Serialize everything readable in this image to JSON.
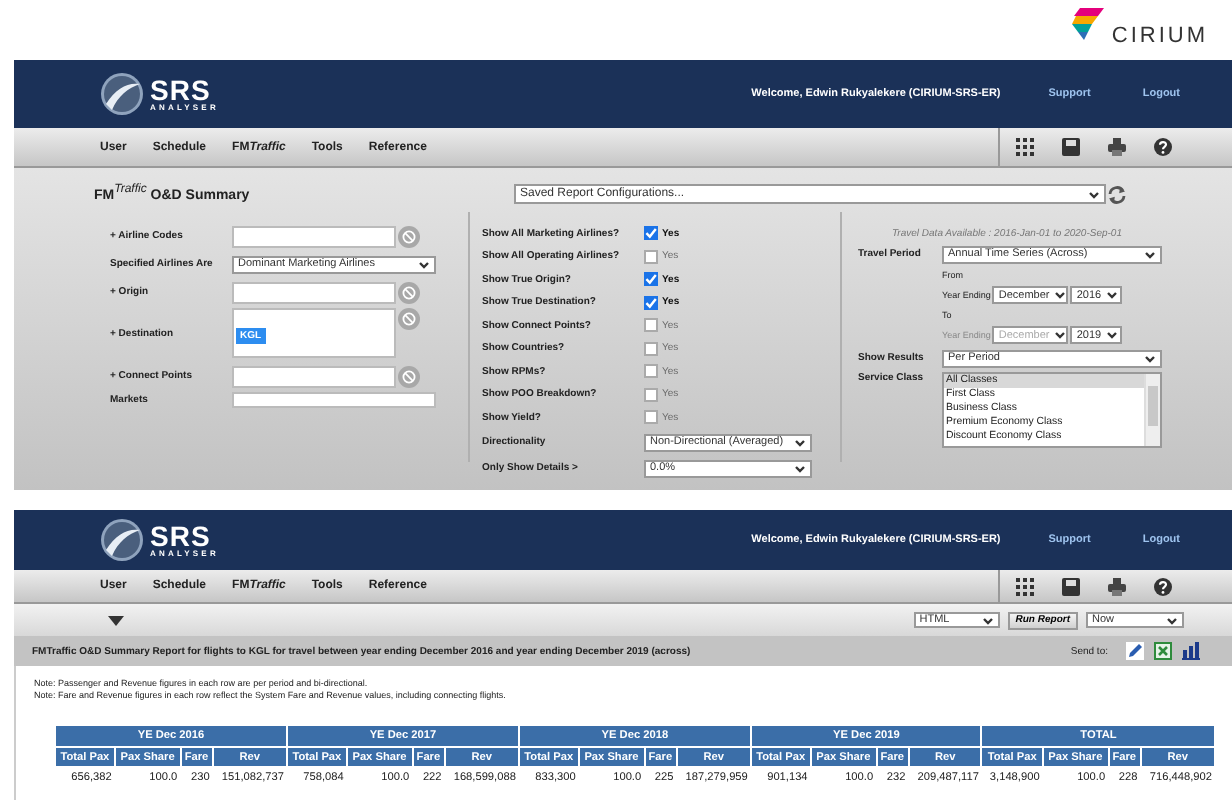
{
  "brand": {
    "name": "CIRIUM"
  },
  "form_screen": {
    "header": {
      "logo_text": "SRS",
      "logo_subtext": "ANALYSER",
      "welcome": "Welcome, Edwin Rukyalekere (CIRIUM-SRS-ER)",
      "links": [
        "Support",
        "Logout"
      ]
    },
    "nav": [
      {
        "label": "User"
      },
      {
        "label": "Schedule"
      },
      {
        "label": "FM",
        "italic_part": "Traffic"
      },
      {
        "label": "Tools"
      },
      {
        "label": "Reference"
      }
    ],
    "title": "FM$^{Traffic}$ O&D Summary",
    "saved_config": {
      "value": "Saved Report Configurations..."
    },
    "fields": [
      {
        "kind": "lookup",
        "label": "+ Airline Codes"
      },
      {
        "kind": "select",
        "label": "Specified Airlines Are",
        "value": "Dominant Marketing Airlines"
      },
      {
        "kind": "lookup",
        "label": "+ Origin"
      },
      {
        "kind": "lookup_tall",
        "label": "+ Destination",
        "tokens": [
          "KGL"
        ]
      },
      {
        "kind": "lookup",
        "label": "+ Connect Points"
      },
      {
        "kind": "text",
        "label": "Markets"
      }
    ],
    "options": [
      {
        "label": "Show All Marketing Airlines?",
        "text": "Yes",
        "checked": true
      },
      {
        "label": "Show All Operating Airlines?",
        "text": "Yes",
        "checked": false
      },
      {
        "label": "Show True Origin?",
        "text": "Yes",
        "checked": true
      },
      {
        "label": "Show True Destination?",
        "text": "Yes",
        "checked": true
      },
      {
        "label": "Show Connect Points?",
        "text": "Yes",
        "checked": false
      },
      {
        "label": "Show Countries?",
        "text": "Yes",
        "checked": false
      },
      {
        "label": "Show RPMs?",
        "text": "Yes",
        "checked": false
      },
      {
        "label": "Show POO Breakdown?",
        "text": "Yes",
        "checked": false
      },
      {
        "label": "Show Yield?",
        "text": "Yes",
        "checked": false
      }
    ],
    "option_selects": [
      {
        "label": "Directionality",
        "value": "Non-Directional (Averaged)"
      },
      {
        "label": "Only Show Details >",
        "value": "0.0%"
      }
    ],
    "availability": "Travel Data Available :  2016-Jan-01 to 2020-Sep-01",
    "travel_period": {
      "label": "Travel Period",
      "value": "Annual Time Series (Across)"
    },
    "range": [
      {
        "caption": "From",
        "label": "Year Ending",
        "month": "December",
        "month_disabled": false,
        "year": "2016"
      },
      {
        "caption": "To",
        "label": "Year Ending",
        "month": "December",
        "month_disabled": true,
        "year": "2019"
      }
    ],
    "show_results": {
      "label": "Show Results",
      "value": "Per Period"
    },
    "service_class": {
      "label": "Service Class",
      "items": [
        {
          "label": "All Classes",
          "selected": true
        },
        {
          "label": "First Class",
          "selected": false
        },
        {
          "label": "Business Class",
          "selected": false
        },
        {
          "label": "Premium Economy Class",
          "selected": false
        },
        {
          "label": "Discount Economy Class",
          "selected": false
        }
      ]
    }
  },
  "report_screen": {
    "header": {
      "logo_text": "SRS",
      "logo_subtext": "ANALYSER",
      "welcome": "Welcome, Edwin Rukyalekere (CIRIUM-SRS-ER)",
      "links": [
        "Support",
        "Logout"
      ]
    },
    "nav": [
      {
        "label": "User"
      },
      {
        "label": "Schedule"
      },
      {
        "label": "FM",
        "italic_part": "Traffic"
      },
      {
        "label": "Tools"
      },
      {
        "label": "Reference"
      }
    ],
    "output_format": "HTML",
    "run_button": "Run Report",
    "run_time": "Now",
    "report_title": "FMTraffic O&D Summary Report for flights to KGL for travel between year ending December 2016 and year ending December 2019 (across)",
    "send_to": "Send to:",
    "notes": [
      "Note: Passenger and Revenue figures in each row are per period and bi-directional.",
      "Note: Fare and Revenue figures in each row reflect the System Fare and Revenue values, including connecting flights."
    ],
    "table": {
      "groups": [
        {
          "title": "YE Dec 2016",
          "columns": [
            "Total Pax",
            "Pax Share",
            "Fare",
            "Rev"
          ]
        },
        {
          "title": "YE Dec 2017",
          "columns": [
            "Total Pax",
            "Pax Share",
            "Fare",
            "Rev"
          ]
        },
        {
          "title": "YE Dec 2018",
          "columns": [
            "Total Pax",
            "Pax Share",
            "Fare",
            "Rev"
          ]
        },
        {
          "title": "YE Dec 2019",
          "columns": [
            "Total Pax",
            "Pax Share",
            "Fare",
            "Rev"
          ]
        },
        {
          "title": "TOTAL",
          "columns": [
            "Total Pax",
            "Pax Share",
            "Fare",
            "Rev"
          ]
        }
      ],
      "rows": [
        [
          "656,382",
          "100.0",
          "230",
          "151,082,737",
          "758,084",
          "100.0",
          "222",
          "168,599,088",
          "833,300",
          "100.0",
          "225",
          "187,279,959",
          "901,134",
          "100.0",
          "232",
          "209,487,117",
          "3,148,900",
          "100.0",
          "228",
          "716,448,902"
        ]
      ]
    }
  }
}
